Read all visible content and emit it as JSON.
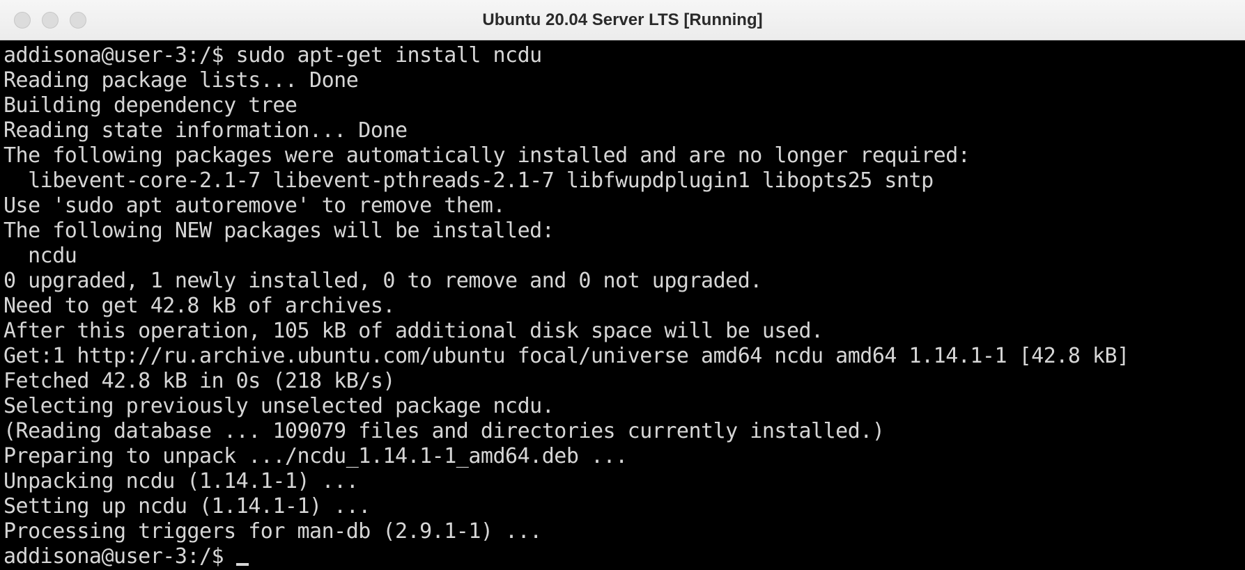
{
  "window": {
    "title": "Ubuntu 20.04 Server LTS [Running]"
  },
  "terminal": {
    "lines": [
      "addisona@user-3:/$ sudo apt-get install ncdu",
      "Reading package lists... Done",
      "Building dependency tree",
      "Reading state information... Done",
      "The following packages were automatically installed and are no longer required:",
      "  libevent-core-2.1-7 libevent-pthreads-2.1-7 libfwupdplugin1 libopts25 sntp",
      "Use 'sudo apt autoremove' to remove them.",
      "The following NEW packages will be installed:",
      "  ncdu",
      "0 upgraded, 1 newly installed, 0 to remove and 0 not upgraded.",
      "Need to get 42.8 kB of archives.",
      "After this operation, 105 kB of additional disk space will be used.",
      "Get:1 http://ru.archive.ubuntu.com/ubuntu focal/universe amd64 ncdu amd64 1.14.1-1 [42.8 kB]",
      "Fetched 42.8 kB in 0s (218 kB/s)",
      "Selecting previously unselected package ncdu.",
      "(Reading database ... 109079 files and directories currently installed.)",
      "Preparing to unpack .../ncdu_1.14.1-1_amd64.deb ...",
      "Unpacking ncdu (1.14.1-1) ...",
      "Setting up ncdu (1.14.1-1) ...",
      "Processing triggers for man-db (2.9.1-1) ..."
    ],
    "prompt": "addisona@user-3:/$ "
  },
  "colors": {
    "terminal_bg": "#000000",
    "terminal_fg": "#d6d6d6",
    "titlebar_bg": "#ececec"
  }
}
